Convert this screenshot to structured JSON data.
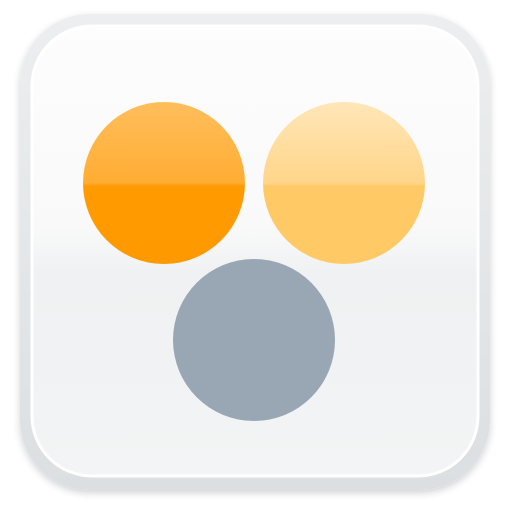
{
  "icon": {
    "name": "app-icon-three-circles",
    "colors": {
      "frame_outer": "#e3e6e8",
      "frame_inner_edge": "#fafafa",
      "face_top": "#fbfbfb",
      "face_bottom": "#f2f3f4",
      "gloss_band": "#eef0f1",
      "orange_dark": "#ff9900",
      "orange_dark_highlight": "#ffb84a",
      "orange_light": "#ffc966",
      "orange_light_highlight": "#ffe2ad",
      "slate": "#99a6b4"
    },
    "circles": [
      {
        "name": "orange-dot",
        "color_key": "orange_dark"
      },
      {
        "name": "light-orange-dot",
        "color_key": "orange_light"
      },
      {
        "name": "gray-dot",
        "color_key": "slate"
      }
    ]
  }
}
